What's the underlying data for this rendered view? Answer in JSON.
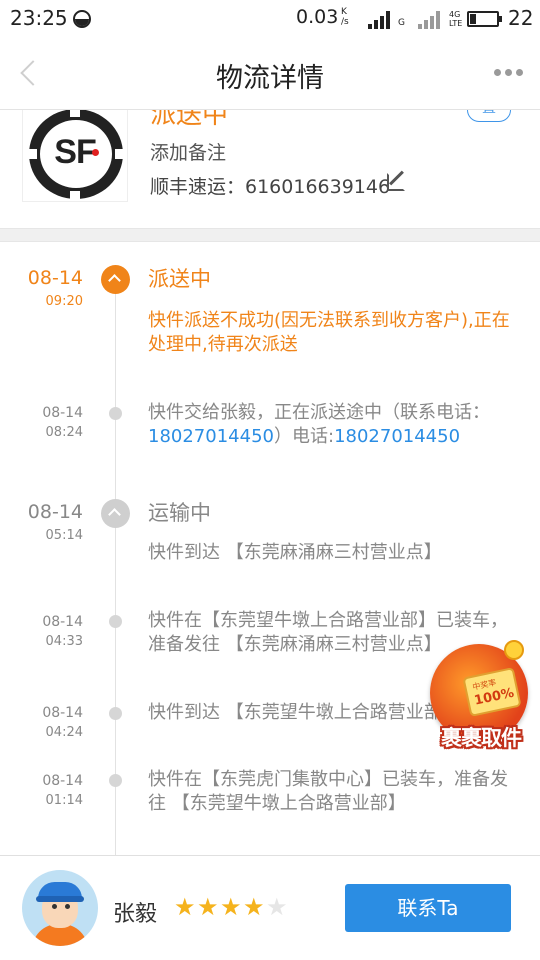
{
  "status_bar": {
    "time": "23:25",
    "speed": "0.03",
    "speed_unit_top": "K",
    "speed_unit_bottom": "/s",
    "network_g": "G",
    "network_4g_top": "4G",
    "network_4g_bottom": "LTE",
    "battery_level": "22",
    "battery_fraction": 0.22
  },
  "header": {
    "title": "物流详情"
  },
  "package": {
    "carrier_logo_text": "SF",
    "status": "派送中",
    "tag": "置",
    "note_label": "添加备注",
    "tracking": "顺丰速运：616016639146"
  },
  "timeline": [
    {
      "date": "08-14",
      "time": "09:20",
      "title": "派送中",
      "text": "快件派送不成功(因无法联系到收方客户),正在处理中,待再次派送",
      "highlight": true
    },
    {
      "date": "08-14",
      "time": "08:24",
      "text_before": "快件交给张毅，正在派送途中（联系电话：",
      "phone1": "18027014450",
      "text_middle": "）电话:",
      "phone2": "18027014450"
    },
    {
      "date": "08-14",
      "time": "05:14",
      "title": "运输中",
      "text": "快件到达 【东莞麻涌麻三村营业点】"
    },
    {
      "date": "08-14",
      "time": "04:33",
      "text": "快件在【东莞望牛墩上合路营业部】已装车，准备发往 【东莞麻涌麻三村营业点】"
    },
    {
      "date": "08-14",
      "time": "04:24",
      "text": "快件到达 【东莞望牛墩上合路营业部】"
    },
    {
      "date": "08-14",
      "time": "01:14",
      "text": "快件在【东莞虎门集散中心】已装车，准备发往 【东莞望牛墩上合路营业部】"
    }
  ],
  "promo": {
    "card_top": "中奖率",
    "card_pct": "100%",
    "label": "裹裹取件"
  },
  "courier": {
    "name": "张毅",
    "rating": 4,
    "rating_max": 5,
    "contact_label": "联系Ta"
  },
  "colors": {
    "accent_orange": "#f08419",
    "link_blue": "#2b8de3",
    "star_gold": "#f5b31d"
  }
}
